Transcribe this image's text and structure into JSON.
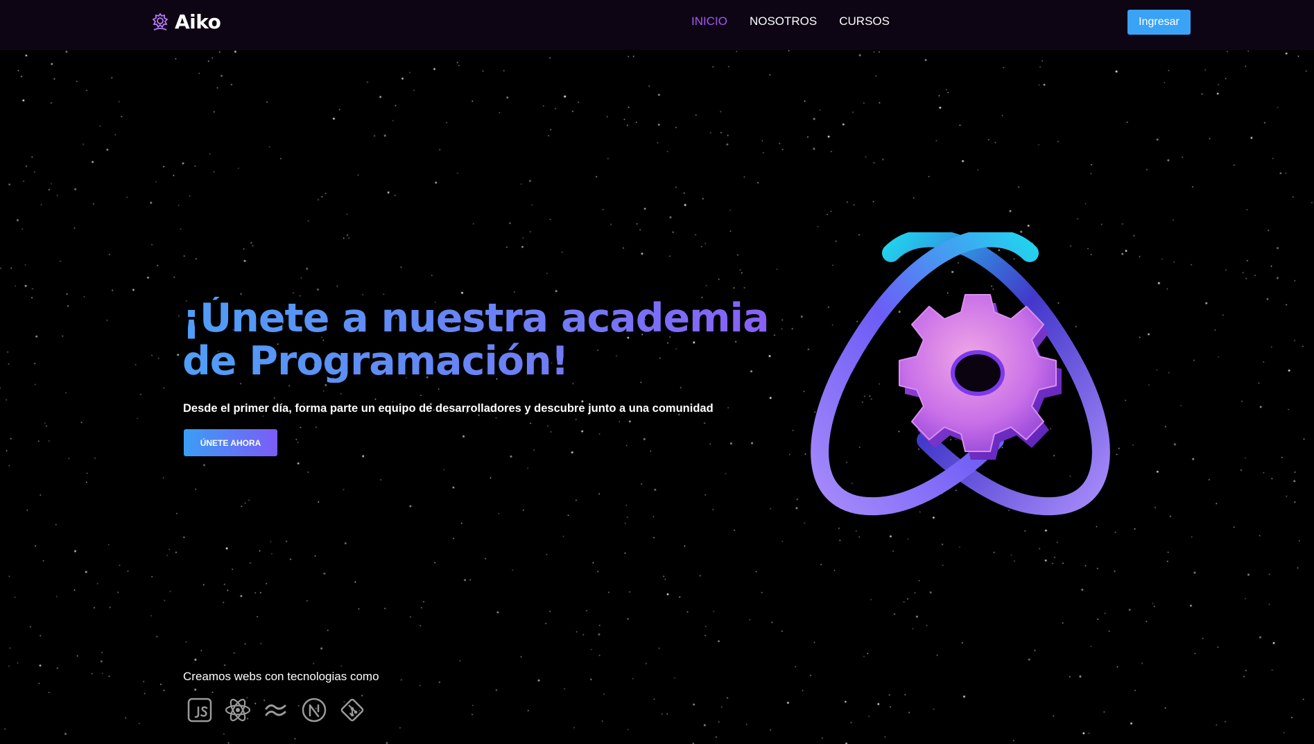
{
  "brand": {
    "name": "Aiko",
    "icon": "gear-atom-icon"
  },
  "nav": {
    "items": [
      {
        "label": "INICIO",
        "active": true
      },
      {
        "label": "NOSOTROS",
        "active": false
      },
      {
        "label": "CURSOS",
        "active": false
      }
    ],
    "login_label": "Ingresar"
  },
  "hero": {
    "title_line1": "¡Únete a nuestra academia",
    "title_line2": "de Programación!",
    "subtitle": "Desde el primer día, forma parte un equipo de desarrolladores y descubre junto a una comunidad",
    "cta_label": "ÚNETE AHORA",
    "illustration": "gear-orbit-illustration"
  },
  "technologies": {
    "caption": "Creamos webs con tecnologias como",
    "icons": [
      "javascript-icon",
      "react-icon",
      "tailwind-icon",
      "nextjs-icon",
      "git-icon"
    ]
  },
  "colors": {
    "background": "#000000",
    "topbar": "#0d0514",
    "accent_purple": "#a855f7",
    "accent_blue": "#3aa3f5",
    "title_gradient_start": "#4f9ef6",
    "title_gradient_end": "#8b5cf6"
  }
}
